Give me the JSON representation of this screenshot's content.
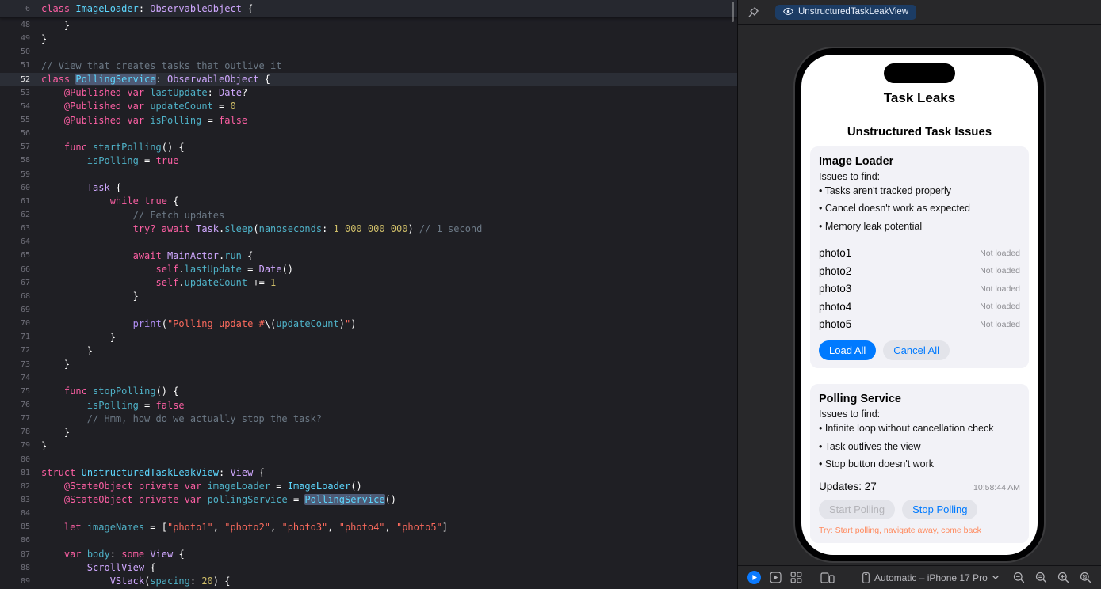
{
  "colors": {
    "accent_blue": "#007aff",
    "editor_bg": "#1f1f24",
    "canvas_bg": "#28282a",
    "tab_bg": "#1c3c64",
    "keyword_pink": "#fc5fa3",
    "string_red": "#fc6a5d",
    "number_yellow": "#d0bf69",
    "comment_gray": "#6c7986",
    "status_gray": "#8e8e93",
    "hint_orange": "#ff8a5e"
  },
  "editor": {
    "sticky": {
      "n": "6",
      "s": [
        [
          "k",
          "class "
        ],
        [
          "t",
          "ImageLoader"
        ],
        [
          "p",
          ": "
        ],
        [
          "s",
          "ObservableObject"
        ],
        [
          "p",
          " {"
        ]
      ]
    },
    "lines": [
      {
        "n": "48",
        "s": [
          [
            "p",
            "    }"
          ]
        ]
      },
      {
        "n": "49",
        "s": [
          [
            "p",
            "}"
          ]
        ]
      },
      {
        "n": "50",
        "s": []
      },
      {
        "n": "51",
        "s": [
          [
            "c",
            "// View that creates tasks that outlive it"
          ]
        ]
      },
      {
        "n": "52",
        "cur": true,
        "s": [
          [
            "k",
            "class "
          ],
          [
            "t sel",
            "PollingService"
          ],
          [
            "p",
            ": "
          ],
          [
            "s",
            "ObservableObject"
          ],
          [
            "p",
            " {"
          ]
        ]
      },
      {
        "n": "53",
        "s": [
          [
            "p",
            "    "
          ],
          [
            "k",
            "@Published"
          ],
          [
            "p",
            " "
          ],
          [
            "k",
            "var"
          ],
          [
            "p",
            " "
          ],
          [
            "d",
            "lastUpdate"
          ],
          [
            "p",
            ": "
          ],
          [
            "s",
            "Date"
          ],
          [
            "p",
            "?"
          ]
        ]
      },
      {
        "n": "54",
        "s": [
          [
            "p",
            "    "
          ],
          [
            "k",
            "@Published"
          ],
          [
            "p",
            " "
          ],
          [
            "k",
            "var"
          ],
          [
            "p",
            " "
          ],
          [
            "d",
            "updateCount"
          ],
          [
            "p",
            " = "
          ],
          [
            "n",
            "0"
          ]
        ]
      },
      {
        "n": "55",
        "s": [
          [
            "p",
            "    "
          ],
          [
            "k",
            "@Published"
          ],
          [
            "p",
            " "
          ],
          [
            "k",
            "var"
          ],
          [
            "p",
            " "
          ],
          [
            "d",
            "isPolling"
          ],
          [
            "p",
            " = "
          ],
          [
            "k",
            "false"
          ]
        ]
      },
      {
        "n": "56",
        "s": []
      },
      {
        "n": "57",
        "s": [
          [
            "p",
            "    "
          ],
          [
            "k",
            "func"
          ],
          [
            "p",
            " "
          ],
          [
            "d",
            "startPolling"
          ],
          [
            "p",
            "() {"
          ]
        ]
      },
      {
        "n": "58",
        "s": [
          [
            "p",
            "        "
          ],
          [
            "d",
            "isPolling"
          ],
          [
            "p",
            " = "
          ],
          [
            "k",
            "true"
          ]
        ]
      },
      {
        "n": "59",
        "s": []
      },
      {
        "n": "60",
        "s": [
          [
            "p",
            "        "
          ],
          [
            "s",
            "Task"
          ],
          [
            "p",
            " {"
          ]
        ]
      },
      {
        "n": "61",
        "s": [
          [
            "p",
            "            "
          ],
          [
            "k",
            "while"
          ],
          [
            "p",
            " "
          ],
          [
            "k",
            "true"
          ],
          [
            "p",
            " {"
          ]
        ]
      },
      {
        "n": "62",
        "s": [
          [
            "p",
            "                "
          ],
          [
            "c",
            "// Fetch updates"
          ]
        ]
      },
      {
        "n": "63",
        "s": [
          [
            "p",
            "                "
          ],
          [
            "k",
            "try?"
          ],
          [
            "p",
            " "
          ],
          [
            "k",
            "await"
          ],
          [
            "p",
            " "
          ],
          [
            "s",
            "Task"
          ],
          [
            "p",
            "."
          ],
          [
            "d",
            "sleep"
          ],
          [
            "p",
            "("
          ],
          [
            "d",
            "nanoseconds"
          ],
          [
            "p",
            ": "
          ],
          [
            "n",
            "1_000_000_000"
          ],
          [
            "p",
            ") "
          ],
          [
            "c",
            "// 1 second"
          ]
        ]
      },
      {
        "n": "64",
        "s": []
      },
      {
        "n": "65",
        "s": [
          [
            "p",
            "                "
          ],
          [
            "k",
            "await"
          ],
          [
            "p",
            " "
          ],
          [
            "s",
            "MainActor"
          ],
          [
            "p",
            "."
          ],
          [
            "d",
            "run"
          ],
          [
            "p",
            " {"
          ]
        ]
      },
      {
        "n": "66",
        "s": [
          [
            "p",
            "                    "
          ],
          [
            "k",
            "self"
          ],
          [
            "p",
            "."
          ],
          [
            "d",
            "lastUpdate"
          ],
          [
            "p",
            " = "
          ],
          [
            "s",
            "Date"
          ],
          [
            "p",
            "()"
          ]
        ]
      },
      {
        "n": "67",
        "s": [
          [
            "p",
            "                    "
          ],
          [
            "k",
            "self"
          ],
          [
            "p",
            "."
          ],
          [
            "d",
            "updateCount"
          ],
          [
            "p",
            " += "
          ],
          [
            "n",
            "1"
          ]
        ]
      },
      {
        "n": "68",
        "s": [
          [
            "p",
            "                }"
          ]
        ]
      },
      {
        "n": "69",
        "s": []
      },
      {
        "n": "70",
        "s": [
          [
            "p",
            "                "
          ],
          [
            "f",
            "print"
          ],
          [
            "p",
            "("
          ],
          [
            "str",
            "\"Polling update #"
          ],
          [
            "p",
            "\\("
          ],
          [
            "d",
            "updateCount"
          ],
          [
            "p",
            ")"
          ],
          [
            "str",
            "\""
          ],
          [
            "p",
            ")"
          ]
        ]
      },
      {
        "n": "71",
        "s": [
          [
            "p",
            "            }"
          ]
        ]
      },
      {
        "n": "72",
        "s": [
          [
            "p",
            "        }"
          ]
        ]
      },
      {
        "n": "73",
        "s": [
          [
            "p",
            "    }"
          ]
        ]
      },
      {
        "n": "74",
        "s": []
      },
      {
        "n": "75",
        "s": [
          [
            "p",
            "    "
          ],
          [
            "k",
            "func"
          ],
          [
            "p",
            " "
          ],
          [
            "d",
            "stopPolling"
          ],
          [
            "p",
            "() {"
          ]
        ]
      },
      {
        "n": "76",
        "s": [
          [
            "p",
            "        "
          ],
          [
            "d",
            "isPolling"
          ],
          [
            "p",
            " = "
          ],
          [
            "k",
            "false"
          ]
        ]
      },
      {
        "n": "77",
        "s": [
          [
            "p",
            "        "
          ],
          [
            "c",
            "// Hmm, how do we actually stop the task?"
          ]
        ]
      },
      {
        "n": "78",
        "s": [
          [
            "p",
            "    }"
          ]
        ]
      },
      {
        "n": "79",
        "s": [
          [
            "p",
            "}"
          ]
        ]
      },
      {
        "n": "80",
        "s": []
      },
      {
        "n": "81",
        "s": [
          [
            "k",
            "struct"
          ],
          [
            "p",
            " "
          ],
          [
            "t",
            "UnstructuredTaskLeakView"
          ],
          [
            "p",
            ": "
          ],
          [
            "s",
            "View"
          ],
          [
            "p",
            " {"
          ]
        ]
      },
      {
        "n": "82",
        "s": [
          [
            "p",
            "    "
          ],
          [
            "k",
            "@StateObject"
          ],
          [
            "p",
            " "
          ],
          [
            "k",
            "private"
          ],
          [
            "p",
            " "
          ],
          [
            "k",
            "var"
          ],
          [
            "p",
            " "
          ],
          [
            "d",
            "imageLoader"
          ],
          [
            "p",
            " = "
          ],
          [
            "t",
            "ImageLoader"
          ],
          [
            "p",
            "()"
          ]
        ]
      },
      {
        "n": "83",
        "s": [
          [
            "p",
            "    "
          ],
          [
            "k",
            "@StateObject"
          ],
          [
            "p",
            " "
          ],
          [
            "k",
            "private"
          ],
          [
            "p",
            " "
          ],
          [
            "k",
            "var"
          ],
          [
            "p",
            " "
          ],
          [
            "d",
            "pollingService"
          ],
          [
            "p",
            " = "
          ],
          [
            "t sel",
            "PollingService"
          ],
          [
            "p",
            "()"
          ]
        ]
      },
      {
        "n": "84",
        "s": []
      },
      {
        "n": "85",
        "s": [
          [
            "p",
            "    "
          ],
          [
            "k",
            "let"
          ],
          [
            "p",
            " "
          ],
          [
            "d",
            "imageNames"
          ],
          [
            "p",
            " = ["
          ],
          [
            "str",
            "\"photo1\""
          ],
          [
            "p",
            ", "
          ],
          [
            "str",
            "\"photo2\""
          ],
          [
            "p",
            ", "
          ],
          [
            "str",
            "\"photo3\""
          ],
          [
            "p",
            ", "
          ],
          [
            "str",
            "\"photo4\""
          ],
          [
            "p",
            ", "
          ],
          [
            "str",
            "\"photo5\""
          ],
          [
            "p",
            "]"
          ]
        ]
      },
      {
        "n": "86",
        "s": []
      },
      {
        "n": "87",
        "s": [
          [
            "p",
            "    "
          ],
          [
            "k",
            "var"
          ],
          [
            "p",
            " "
          ],
          [
            "d",
            "body"
          ],
          [
            "p",
            ": "
          ],
          [
            "k",
            "some"
          ],
          [
            "p",
            " "
          ],
          [
            "s",
            "View"
          ],
          [
            "p",
            " {"
          ]
        ]
      },
      {
        "n": "88",
        "s": [
          [
            "p",
            "        "
          ],
          [
            "s",
            "ScrollView"
          ],
          [
            "p",
            " {"
          ]
        ]
      },
      {
        "n": "89",
        "s": [
          [
            "p",
            "            "
          ],
          [
            "s",
            "VStack"
          ],
          [
            "p",
            "("
          ],
          [
            "d",
            "spacing"
          ],
          [
            "p",
            ": "
          ],
          [
            "n",
            "20"
          ],
          [
            "p",
            ") {"
          ]
        ]
      }
    ]
  },
  "canvas": {
    "tab_label": "UnstructuredTaskLeakView",
    "phone": {
      "title": "Task Leaks",
      "subtitle": "Unstructured Task Issues",
      "card1": {
        "title": "Image Loader",
        "issues_label": "Issues to find:",
        "bullets": [
          "• Tasks aren't tracked properly",
          "• Cancel doesn't work as expected",
          "• Memory leak potential"
        ],
        "photos": [
          {
            "name": "photo1",
            "status": "Not loaded"
          },
          {
            "name": "photo2",
            "status": "Not loaded"
          },
          {
            "name": "photo3",
            "status": "Not loaded"
          },
          {
            "name": "photo4",
            "status": "Not loaded"
          },
          {
            "name": "photo5",
            "status": "Not loaded"
          }
        ],
        "buttons": [
          {
            "label": "Load All"
          },
          {
            "label": "Cancel All"
          }
        ]
      },
      "card2": {
        "title": "Polling Service",
        "issues_label": "Issues to find:",
        "bullets": [
          "• Infinite loop without cancellation check",
          "• Task outlives the view",
          "• Stop button doesn't work"
        ],
        "updates_label": "Updates: 27",
        "time": "10:58:44 AM",
        "buttons": [
          {
            "label": "Start Polling",
            "disabled": true
          },
          {
            "label": "Stop Polling"
          }
        ],
        "hint": "Try: Start polling, navigate away, come back"
      }
    },
    "toolbar": {
      "device_label": "Automatic – iPhone 17 Pro"
    }
  }
}
